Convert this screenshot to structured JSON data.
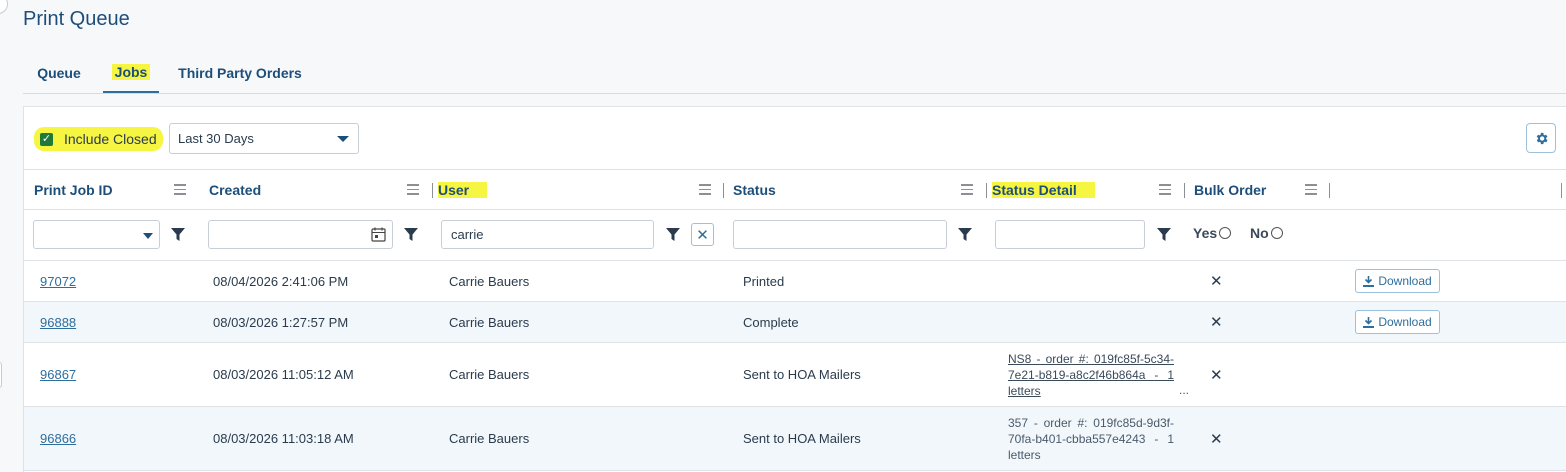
{
  "page": {
    "title": "Print Queue"
  },
  "tabs": [
    {
      "label": "Queue",
      "active": false
    },
    {
      "label": "Jobs",
      "active": true
    },
    {
      "label": "Third Party Orders",
      "active": false
    }
  ],
  "toolbar": {
    "include_closed_label": "Include Closed",
    "include_closed_checked": true,
    "period_value": "Last 30 Days"
  },
  "columns": [
    {
      "key": "print_job_id",
      "label": "Print Job ID"
    },
    {
      "key": "created",
      "label": "Created"
    },
    {
      "key": "user",
      "label": "User",
      "highlighted": true
    },
    {
      "key": "status",
      "label": "Status"
    },
    {
      "key": "status_detail",
      "label": "Status Detail",
      "highlighted": true
    },
    {
      "key": "bulk_order",
      "label": "Bulk Order"
    }
  ],
  "filters": {
    "user_value": "carrie",
    "bulk_yes_label": "Yes",
    "bulk_no_label": "No"
  },
  "rows": [
    {
      "id": "97072",
      "created": "08/04/2026 2:41:06 PM",
      "user": "Carrie Bauers",
      "status": "Printed",
      "detail": "",
      "detail_link": false,
      "bulk": "✕",
      "download_label": "Download"
    },
    {
      "id": "96888",
      "created": "08/03/2026 1:27:57 PM",
      "user": "Carrie Bauers",
      "status": "Complete",
      "detail": "",
      "detail_link": false,
      "bulk": "✕",
      "download_label": "Download"
    },
    {
      "id": "96867",
      "created": "08/03/2026 11:05:12 AM",
      "user": "Carrie Bauers",
      "status": "Sent to HOA Mailers",
      "detail": "NS8 - order #: 019fc85f-5c34-7e21-b819-a8c2f46b864a - 1 letters",
      "detail_link": true,
      "detail_more": "...",
      "bulk": "✕",
      "download_label": ""
    },
    {
      "id": "96866",
      "created": "08/03/2026 11:03:18 AM",
      "user": "Carrie Bauers",
      "status": "Sent to HOA Mailers",
      "detail": "357 - order #: 019fc85d-9d3f-70fa-b401-cbba557e4243 - 1 letters",
      "detail_link": false,
      "bulk": "✕",
      "download_label": ""
    }
  ]
}
